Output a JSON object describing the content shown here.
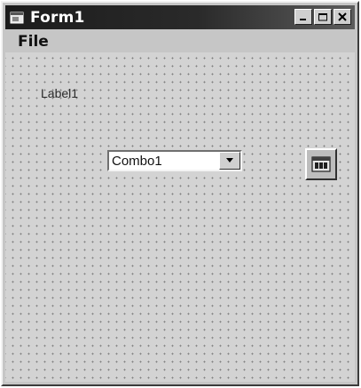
{
  "window": {
    "title": "Form1",
    "title_icon": "form-icon",
    "controls": [
      "minimize-icon",
      "maximize-icon",
      "close-icon"
    ]
  },
  "menu": {
    "items": [
      {
        "label": "File"
      }
    ]
  },
  "form": {
    "label": {
      "text": "Label1"
    },
    "combo": {
      "value": "Combo1",
      "dropdown_icon": "chevron-down-icon"
    },
    "control_icon": "timer-control-icon"
  },
  "colors": {
    "titlebar": "#1c1c1c",
    "face": "#c6c6c6",
    "grid_dot": "#7f7f7f"
  }
}
